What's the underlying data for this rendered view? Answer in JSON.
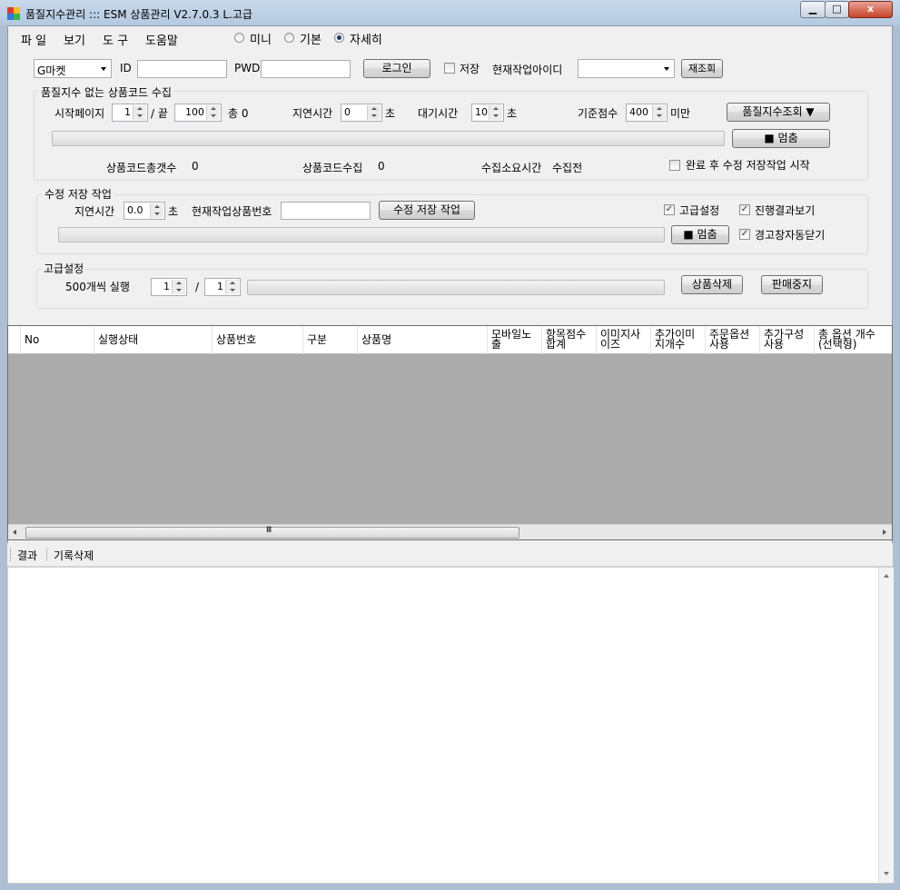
{
  "window": {
    "title": "품질지수관리 ::: ESM 상품관리 V2.7.0.3 L.고급",
    "min_glyph": "▁",
    "max_glyph": "□",
    "close_glyph": "x"
  },
  "menu": {
    "items": [
      "파 일",
      "보기",
      "도 구",
      "도움말"
    ],
    "view_modes": [
      {
        "label": "미니",
        "selected": false
      },
      {
        "label": "기본",
        "selected": false
      },
      {
        "label": "자세히",
        "selected": true
      }
    ]
  },
  "login": {
    "market": "G마켓",
    "id_label": "ID",
    "id_value": "",
    "pwd_label": "PWD",
    "pwd_value": "",
    "login_button": "로그인",
    "save_label": "저장",
    "save_checked": false,
    "current_id_label": "현재작업아이디",
    "current_id_value": "",
    "refresh_button": "재조회"
  },
  "collect": {
    "title": "품질지수 없는 상품코드 수집",
    "start_page_label": "시작페이지",
    "start_page": "1",
    "slash_end": "/ 끝",
    "end_page": "100",
    "total_label": "총 0",
    "delay_label": "지연시간",
    "delay_value": "0",
    "sec1": "초",
    "wait_label": "대기시간",
    "wait_value": "10",
    "sec2": "초",
    "score_label": "기준점수",
    "score_value": "400",
    "below_label": "미만",
    "query_button": "품질지수조회 ▼",
    "stop_button": "■ 멈춤",
    "progress": 0,
    "total_codes_label": "상품코드총갯수",
    "total_codes_value": "0",
    "collected_label": "상품코드수집",
    "collected_value": "0",
    "time_label": "수집소요시간",
    "time_value": "수집전",
    "auto_start_label": "완료 후 수정 저장작업 시작",
    "auto_start_checked": false
  },
  "save_work": {
    "title": "수정 저장 작업",
    "delay_label": "지연시간",
    "delay_value": "0.0",
    "sec": "초",
    "current_product_label": "현재작업상품번호",
    "current_product_value": "",
    "save_button": "수정 저장 작업",
    "advanced_label": "고급설정",
    "advanced_checked": true,
    "show_results_label": "진행결과보기",
    "show_results_checked": true,
    "stop_button": "■ 멈춤",
    "auto_close_label": "경고창자동닫기",
    "auto_close_checked": true,
    "progress": 0
  },
  "advanced": {
    "title": "고급설정",
    "batch_label": "500개씩 실행",
    "batch_current": "1",
    "slash": "/",
    "batch_total": "1",
    "delete_button": "상품삭제",
    "stop_sale_button": "판매중지",
    "progress": 0
  },
  "grid": {
    "columns": [
      [
        "No"
      ],
      [
        "실행상태"
      ],
      [
        "상품번호"
      ],
      [
        "구분"
      ],
      [
        "상품명"
      ],
      [
        "모바일노",
        "출"
      ],
      [
        "항목점수",
        "합계"
      ],
      [
        "이미지사",
        "이즈"
      ],
      [
        "추가이미",
        "지개수"
      ],
      [
        "주문옵션",
        "사용"
      ],
      [
        "추가구성",
        "사용"
      ],
      [
        "총 옵션 개수",
        "(선택형)"
      ]
    ],
    "scroll_thumb_glyph": "Ⅲ"
  },
  "log": {
    "tabs": [
      "결과",
      "기록삭제"
    ]
  }
}
